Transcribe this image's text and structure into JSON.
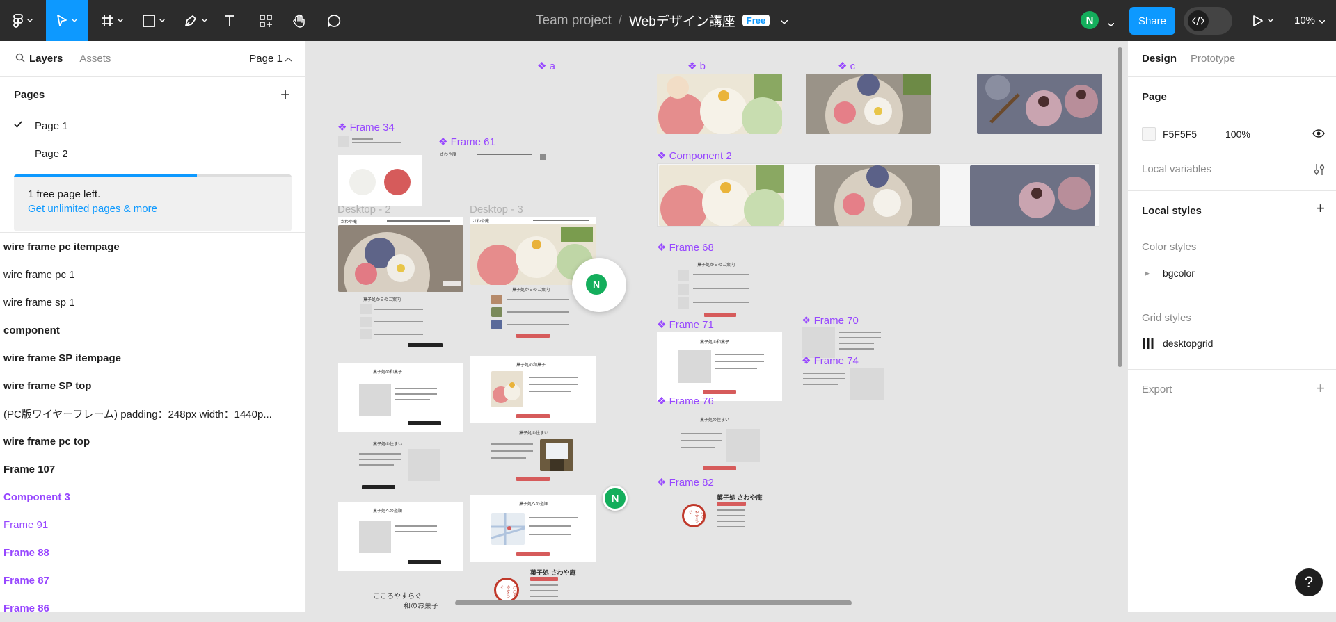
{
  "toolbar": {
    "file_team": "Team project",
    "file_sep": "/",
    "file_name": "Webデザイン講座",
    "badge": "Free",
    "share": "Share",
    "zoom": "10%",
    "avatar": "N"
  },
  "left": {
    "tab_layers": "Layers",
    "tab_assets": "Assets",
    "page_selector": "Page 1",
    "pages_title": "Pages",
    "pages": [
      "Page 1",
      "Page 2"
    ],
    "upsell_text": "1 free page left.",
    "upsell_link": "Get unlimited pages & more",
    "upsell_progress": 0.66,
    "layers": [
      {
        "label": "wire frame pc itempage",
        "style": "b"
      },
      {
        "label": "wire frame pc 1",
        "style": ""
      },
      {
        "label": "wire frame sp 1",
        "style": ""
      },
      {
        "label": "component",
        "style": "b"
      },
      {
        "label": "wire frame SP itempage",
        "style": "b"
      },
      {
        "label": "wire frame SP top",
        "style": "b"
      },
      {
        "label": "(PC版ワイヤーフレーム) padding：248px width：1440p...",
        "style": ""
      },
      {
        "label": "wire frame pc top",
        "style": "b"
      },
      {
        "label": "Frame 107",
        "style": "b"
      },
      {
        "label": "Component 3",
        "style": "b comp"
      },
      {
        "label": "Frame 91",
        "style": "comp"
      },
      {
        "label": "Frame 88",
        "style": "b comp"
      },
      {
        "label": "Frame 87",
        "style": "b comp"
      },
      {
        "label": "Frame 86",
        "style": "b comp"
      }
    ]
  },
  "right": {
    "tab_design": "Design",
    "tab_prototype": "Prototype",
    "page_title": "Page",
    "page_color": "F5F5F5",
    "page_opacity": "100%",
    "local_variables": "Local variables",
    "local_styles": "Local styles",
    "color_styles": "Color styles",
    "color_style_item": "bgcolor",
    "grid_styles": "Grid styles",
    "grid_style_item": "desktopgrid",
    "export": "Export"
  },
  "canvas": {
    "labels": {
      "frame34": "Frame 34",
      "frame61": "Frame 61",
      "desktop2": "Desktop - 2",
      "desktop3": "Desktop - 3",
      "a": "a",
      "b": "b",
      "c": "c",
      "component2": "Component 2",
      "frame68": "Frame 68",
      "frame71": "Frame 71",
      "frame70": "Frame 70",
      "frame74": "Frame 74",
      "frame76": "Frame 76",
      "frame82": "Frame 82"
    },
    "mini_texts": {
      "sawaya": "さわや庵",
      "sawaya_small": "さわや庵",
      "shop_title": "菓子処 さわや庵",
      "about": "菓子処からのご案内",
      "wagashi": "菓子処の和菓子",
      "sumai": "菓子処の住まい",
      "access": "菓子処への道順",
      "tagline1": "こころやすらぐ",
      "tagline2": "和のお菓子",
      "stamp": "こころやすらぐ"
    },
    "cursor_user": "N"
  },
  "colors": {
    "accent": "#0d99ff",
    "component": "#9747ff",
    "avatar": "#14ae5c",
    "red": "#d65b5b"
  }
}
